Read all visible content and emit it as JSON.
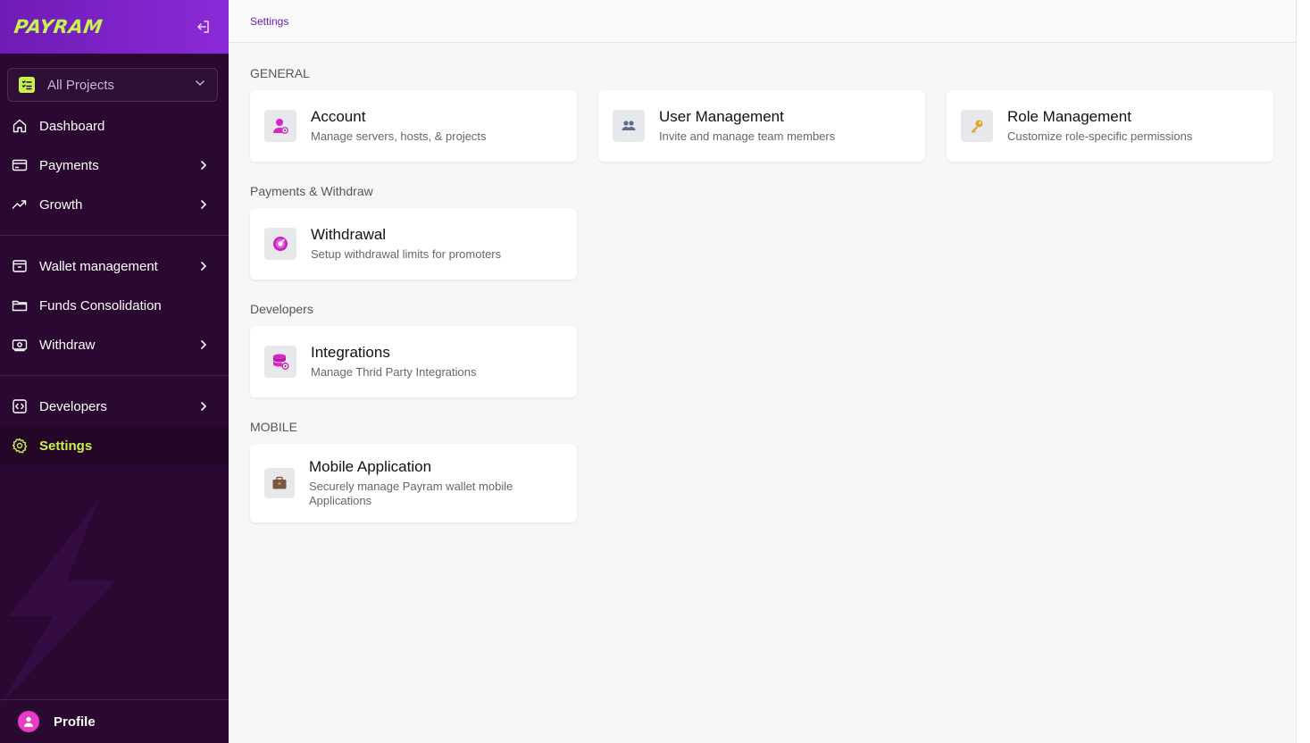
{
  "brand": {
    "logo_text": "PAYRAM"
  },
  "project_selector": {
    "label": "All Projects"
  },
  "nav": {
    "dashboard": "Dashboard",
    "payments": "Payments",
    "growth": "Growth",
    "wallet_management": "Wallet management",
    "funds_consolidation": "Funds Consolidation",
    "withdraw": "Withdraw",
    "developers": "Developers",
    "settings": "Settings"
  },
  "profile": {
    "label": "Profile"
  },
  "breadcrumb": "Settings",
  "sections": {
    "general": "GENERAL",
    "payments_withdraw": "Payments & Withdraw",
    "developers": "Developers",
    "mobile": "MOBILE"
  },
  "cards": {
    "account": {
      "title": "Account",
      "desc": "Manage servers, hosts, & projects"
    },
    "user_management": {
      "title": "User Management",
      "desc": "Invite and manage team members"
    },
    "role_management": {
      "title": "Role Management",
      "desc": "Customize role-specific permissions"
    },
    "withdrawal": {
      "title": "Withdrawal",
      "desc": "Setup withdrawal limits for promoters"
    },
    "integrations": {
      "title": "Integrations",
      "desc": "Manage Thrid Party Integrations"
    },
    "mobile_application": {
      "title": "Mobile Application",
      "desc": "Securely manage Payram wallet mobile Applications"
    }
  },
  "colors": {
    "accent": "#c5f24f",
    "sidebar_bg": "#2a0832",
    "header_purple": "#7a22c6",
    "breadcrumb": "#6f1bb5"
  },
  "icons": {
    "collapse": "collapse-sidebar-icon",
    "project": "checklist-icon",
    "dashboard": "home-icon",
    "payments": "card-icon",
    "growth": "trend-icon",
    "wallet": "wallet-icon",
    "funds": "folder-icon",
    "withdraw": "cash-icon",
    "developers": "code-icon",
    "settings": "gear-icon"
  }
}
